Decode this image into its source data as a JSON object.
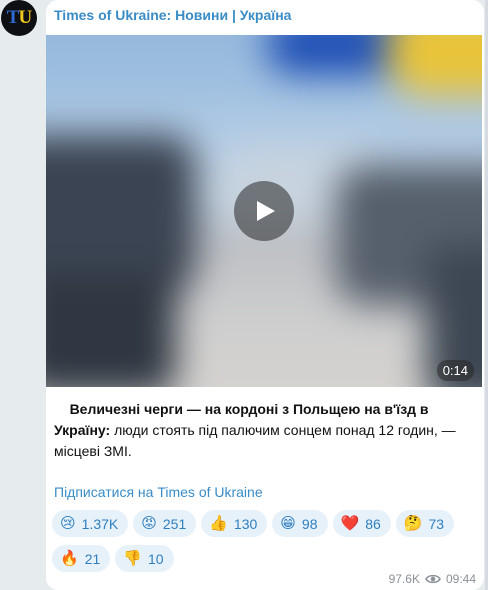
{
  "channel": {
    "name": "Times of Ukraine: Новини | Україна",
    "avatar_letters": [
      "T",
      "U"
    ]
  },
  "video": {
    "duration": "0:14",
    "play_icon": "play-icon"
  },
  "caption": {
    "bold": "Величезні черги — на кордоні з Польщею на в'їзд в Україну:",
    "rest": " люди стоять під палючим сонцем понад 12 годин, — місцеві ЗМІ."
  },
  "subscribe_link": "Підписатися на Times of Ukraine",
  "reactions": [
    {
      "emoji": "😢",
      "name": "crying-face",
      "count": "1.37K"
    },
    {
      "emoji": "😡",
      "name": "angry-face",
      "count": "251"
    },
    {
      "emoji": "👍",
      "name": "thumbs-up",
      "count": "130"
    },
    {
      "emoji": "😁",
      "name": "grinning-face",
      "count": "98"
    },
    {
      "emoji": "❤️",
      "name": "red-heart",
      "count": "86"
    },
    {
      "emoji": "🤔",
      "name": "thinking-face",
      "count": "73"
    },
    {
      "emoji": "🔥",
      "name": "fire",
      "count": "21"
    },
    {
      "emoji": "👎",
      "name": "thumbs-down",
      "count": "10"
    }
  ],
  "meta": {
    "views": "97.6K",
    "views_icon": "eye-icon",
    "time": "09:44"
  },
  "colors": {
    "link": "#3a8cc7",
    "reaction_bg": "#e7f1fa",
    "background": "#e6ebee"
  }
}
